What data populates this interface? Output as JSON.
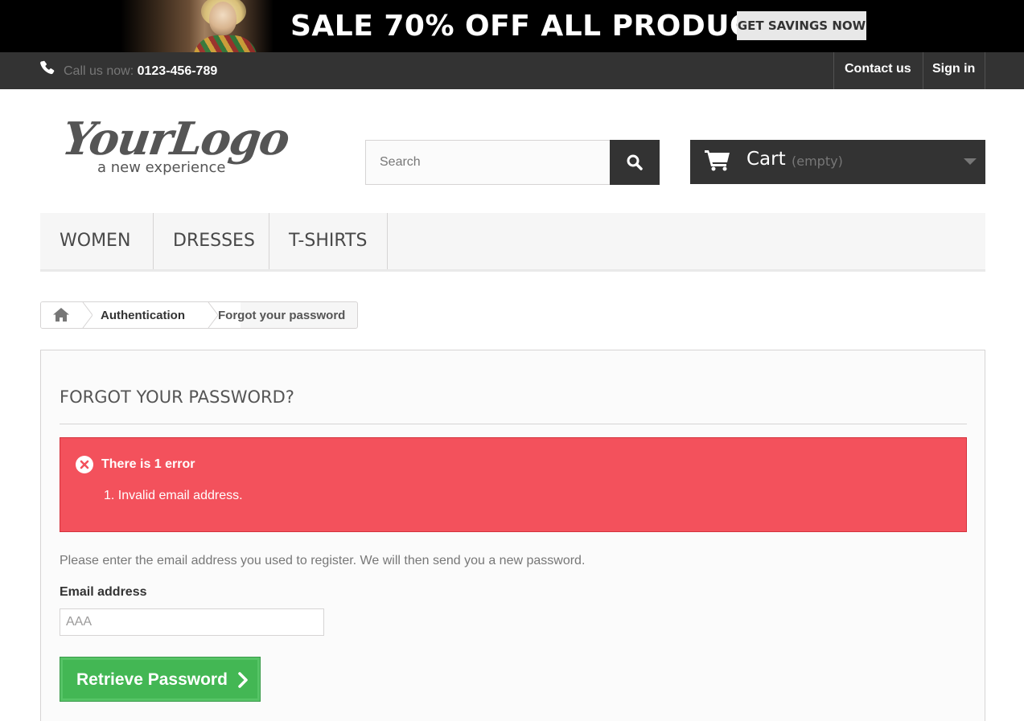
{
  "promo": {
    "headline": "SALE 70% OFF ALL PRODUCTS",
    "cta_label": "GET SAVINGS NOW"
  },
  "topbar": {
    "call_prefix": "Call us now: ",
    "phone": "0123-456-789",
    "contact_label": "Contact us",
    "signin_label": "Sign in",
    "phone_icon": "phone-icon"
  },
  "header": {
    "logo_main": "YourLogo",
    "logo_tagline": "a new experience",
    "search_placeholder": "Search",
    "cart_label": "Cart",
    "cart_status": "(empty)"
  },
  "menu": {
    "items": [
      {
        "label": "WOMEN"
      },
      {
        "label": "DRESSES"
      },
      {
        "label": "T-SHIRTS"
      }
    ]
  },
  "breadcrumb": {
    "home_icon": "home-icon",
    "items": [
      {
        "label": "Authentication"
      },
      {
        "label": "Forgot your password"
      }
    ]
  },
  "form": {
    "heading": "FORGOT YOUR PASSWORD?",
    "error_title": "There is 1 error",
    "errors": [
      "1. Invalid email address."
    ],
    "intro": "Please enter the email address you used to register. We will then send you a new password.",
    "email_label": "Email address",
    "email_value": "AAA",
    "submit_label": "Retrieve Password"
  },
  "colors": {
    "topbar_bg": "#333333",
    "error_bg": "#f3515c",
    "submit_bg": "#43b754"
  }
}
